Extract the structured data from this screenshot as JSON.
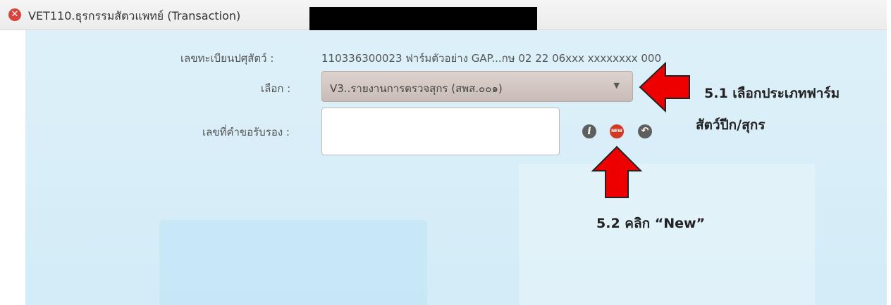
{
  "window": {
    "title": "VET110.ธุรกรรมสัตวแพทย์ (Transaction)",
    "close_glyph": "✕"
  },
  "form": {
    "reg_label": "เลขทะเบียนปศุสัตว์ :",
    "reg_value": "110336300023   ฟาร์มตัวอย่าง GAP...กษ 02 22 06xxx xxxxxxxx 000",
    "select_label": "เลือก :",
    "select_value": "V3..รายงานการตรวจสุกร (สพส.๐๐๑)",
    "select_arrow": "▼",
    "request_label": "เลขที่คำขอรับรอง :",
    "request_value": ""
  },
  "icons": {
    "info": {
      "name": "info-icon",
      "glyph": "i"
    },
    "new": {
      "name": "new-icon",
      "glyph": "NEW",
      "color": "#d23a22"
    },
    "back": {
      "name": "back-icon",
      "glyph": "↶"
    }
  },
  "annotations": {
    "step1_line1": "5.1 เลือกประเภทฟาร์ม",
    "step1_line2": "สัตว์ปีก/สุกร",
    "step2": "5.2 คลิก “New”",
    "arrow_color": "#ee0000"
  }
}
